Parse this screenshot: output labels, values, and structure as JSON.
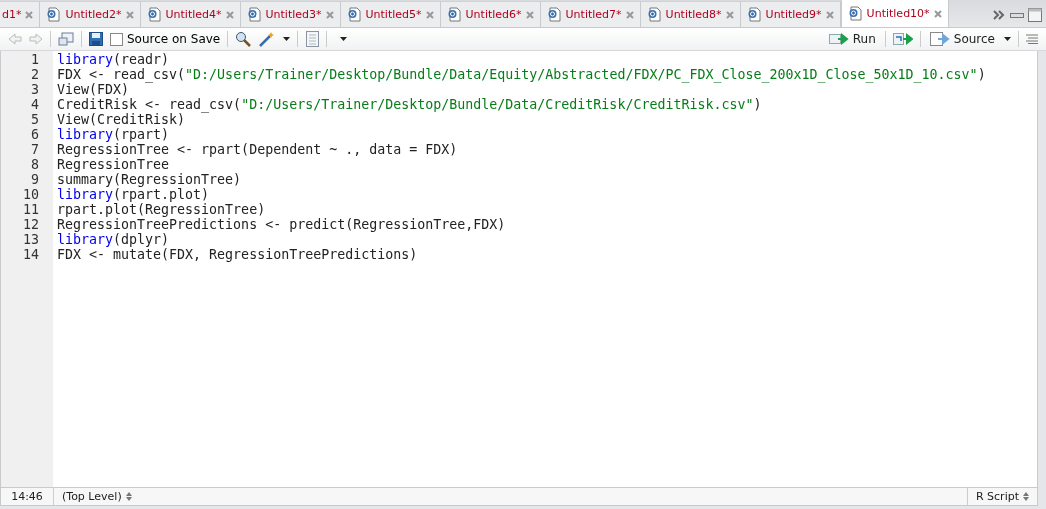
{
  "tabs": [
    {
      "label": "d1*",
      "selected": false
    },
    {
      "label": "Untitled2*",
      "selected": false
    },
    {
      "label": "Untitled4*",
      "selected": false
    },
    {
      "label": "Untitled3*",
      "selected": false
    },
    {
      "label": "Untitled5*",
      "selected": false
    },
    {
      "label": "Untitled6*",
      "selected": false
    },
    {
      "label": "Untitled7*",
      "selected": false
    },
    {
      "label": "Untitled8*",
      "selected": false
    },
    {
      "label": "Untitled9*",
      "selected": false
    },
    {
      "label": "Untitled10*",
      "selected": true
    }
  ],
  "toolbar": {
    "source_on_save": {
      "label": "Source on Save",
      "checked": false
    },
    "run_label": "Run",
    "source_label": "Source"
  },
  "editor": {
    "lines": [
      {
        "number": "1",
        "tokens": [
          {
            "kind": "keyword",
            "text": "library"
          },
          {
            "kind": "plain",
            "text": "(readr)"
          }
        ]
      },
      {
        "number": "2",
        "tokens": [
          {
            "kind": "plain",
            "text": "FDX <- read_csv("
          },
          {
            "kind": "string",
            "text": "\"D:/Users/Trainer/Desktop/Bundle/Data/Equity/Abstracted/FDX/PC_FDX_Close_200x1D_Close_50x1D_10.csv\""
          },
          {
            "kind": "plain",
            "text": ")"
          }
        ]
      },
      {
        "number": "3",
        "tokens": [
          {
            "kind": "plain",
            "text": "View(FDX)"
          }
        ]
      },
      {
        "number": "4",
        "tokens": [
          {
            "kind": "plain",
            "text": "CreditRisk <- read_csv("
          },
          {
            "kind": "string",
            "text": "\"D:/Users/Trainer/Desktop/Bundle/Data/CreditRisk/CreditRisk.csv\""
          },
          {
            "kind": "plain",
            "text": ")"
          }
        ]
      },
      {
        "number": "5",
        "tokens": [
          {
            "kind": "plain",
            "text": "View(CreditRisk)"
          }
        ]
      },
      {
        "number": "6",
        "tokens": [
          {
            "kind": "keyword",
            "text": "library"
          },
          {
            "kind": "plain",
            "text": "(rpart)"
          }
        ]
      },
      {
        "number": "7",
        "tokens": [
          {
            "kind": "plain",
            "text": "RegressionTree <- rpart(Dependent ~ ., data = FDX)"
          }
        ]
      },
      {
        "number": "8",
        "tokens": [
          {
            "kind": "plain",
            "text": "RegressionTree"
          }
        ]
      },
      {
        "number": "9",
        "tokens": [
          {
            "kind": "plain",
            "text": "summary(RegressionTree)"
          }
        ]
      },
      {
        "number": "10",
        "tokens": [
          {
            "kind": "keyword",
            "text": "library"
          },
          {
            "kind": "plain",
            "text": "(rpart.plot)"
          }
        ]
      },
      {
        "number": "11",
        "tokens": [
          {
            "kind": "plain",
            "text": "rpart.plot(RegressionTree)"
          }
        ]
      },
      {
        "number": "12",
        "tokens": [
          {
            "kind": "plain",
            "text": "RegressionTreePredictions <- predict(RegressionTree,FDX)"
          }
        ]
      },
      {
        "number": "13",
        "tokens": [
          {
            "kind": "keyword",
            "text": "library"
          },
          {
            "kind": "plain",
            "text": "(dplyr)"
          }
        ]
      },
      {
        "number": "14",
        "tokens": [
          {
            "kind": "plain",
            "text": "FDX <- mutate(FDX, RegressionTreePredictions)"
          }
        ]
      }
    ]
  },
  "status_bar": {
    "position": "14:46",
    "scope": "(Top Level)",
    "file_type": "R Script"
  }
}
